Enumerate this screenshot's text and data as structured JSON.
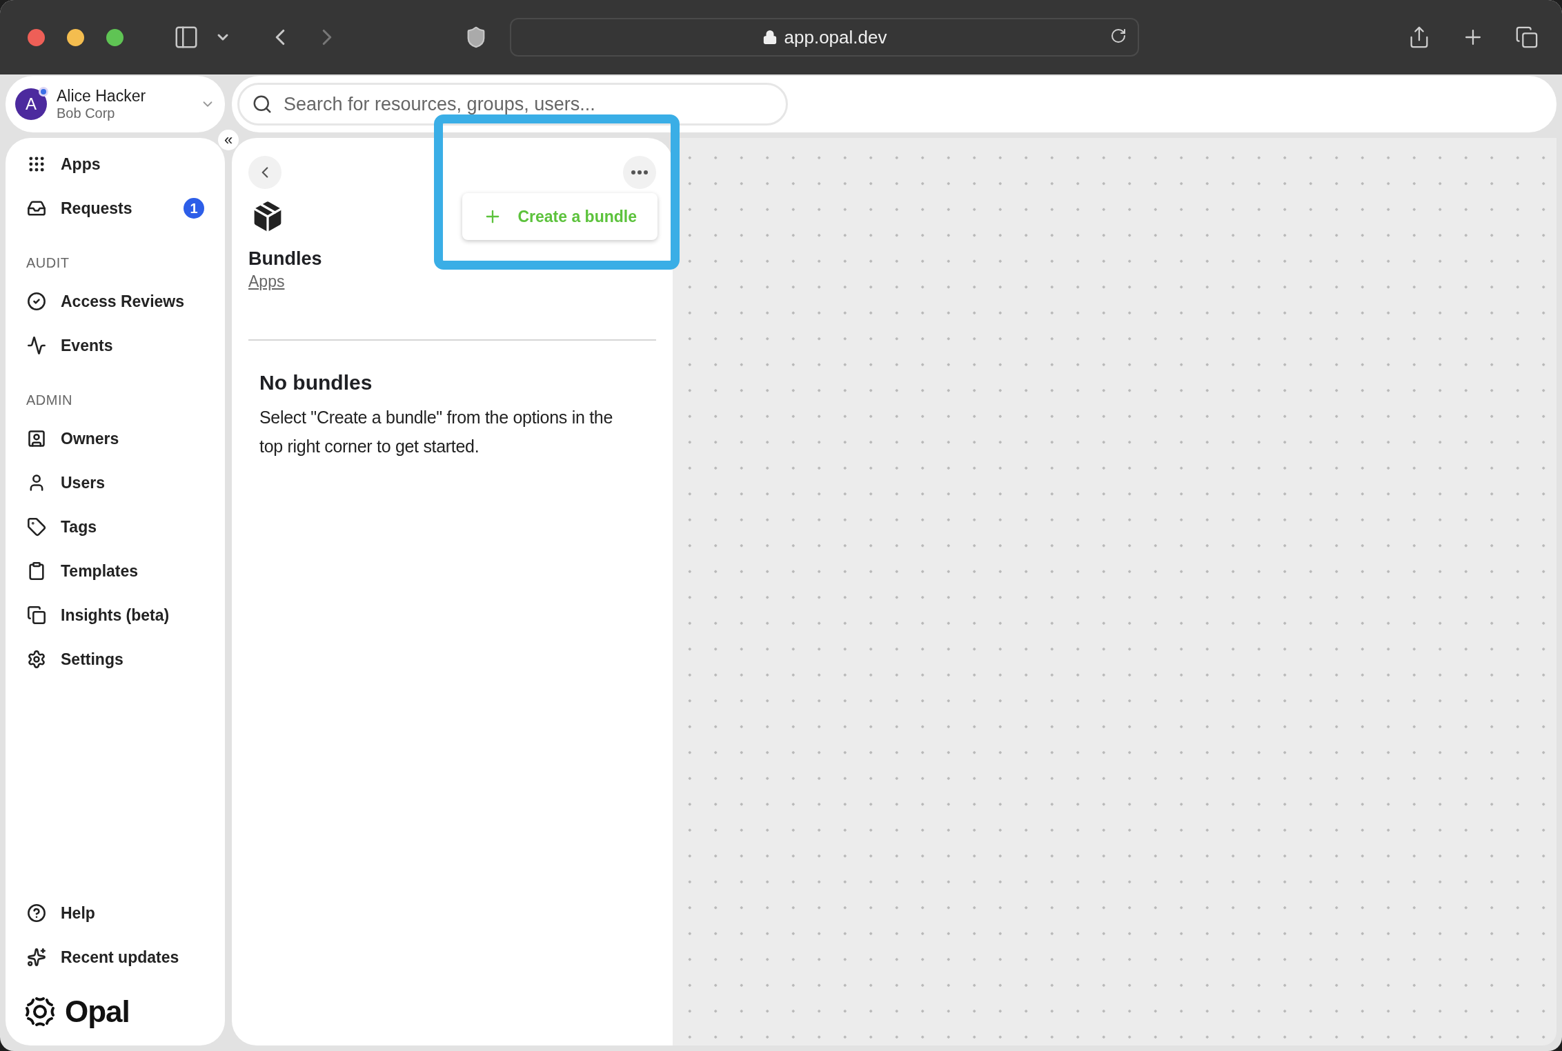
{
  "browser": {
    "url": "app.opal.dev"
  },
  "account": {
    "initial": "A",
    "name": "Alice Hacker",
    "org": "Bob Corp"
  },
  "search": {
    "placeholder": "Search for resources, groups, users..."
  },
  "collapse_button": {
    "label": "«"
  },
  "sidebar": {
    "sections": [
      {
        "items": [
          {
            "label": "Apps"
          },
          {
            "label": "Requests",
            "badge": "1"
          }
        ]
      },
      {
        "heading": "AUDIT",
        "items": [
          {
            "label": "Access Reviews"
          },
          {
            "label": "Events"
          }
        ]
      },
      {
        "heading": "ADMIN",
        "items": [
          {
            "label": "Owners"
          },
          {
            "label": "Users"
          },
          {
            "label": "Tags"
          },
          {
            "label": "Templates"
          },
          {
            "label": "Insights (beta)"
          },
          {
            "label": "Settings"
          }
        ]
      }
    ],
    "footer_items": [
      {
        "label": "Help"
      },
      {
        "label": "Recent updates"
      }
    ],
    "logo": "Opal"
  },
  "panel": {
    "title": "Bundles",
    "breadcrumb": "Apps",
    "menu": [
      {
        "label": "Create a bundle"
      }
    ],
    "empty_state": {
      "title": "No bundles",
      "text": "Select \"Create a bundle\" from the options in the top right corner to get started."
    }
  }
}
